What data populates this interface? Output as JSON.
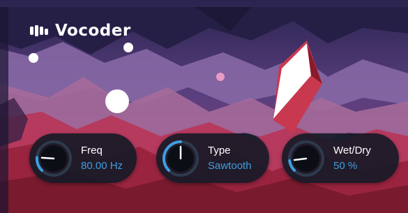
{
  "plugin": {
    "title": "Vocoder"
  },
  "controls": [
    {
      "id": "freq",
      "label": "Freq",
      "value": "80.00 Hz",
      "knob_fraction": 0.18
    },
    {
      "id": "type",
      "label": "Type",
      "value": "Sawtooth",
      "knob_fraction": 0.5
    },
    {
      "id": "wetdry",
      "label": "Wet/Dry",
      "value": "50 %",
      "knob_fraction": 0.14
    }
  ],
  "colors": {
    "accent": "#3d9fe0",
    "panel": "#141a26",
    "text": "#ffffff"
  }
}
